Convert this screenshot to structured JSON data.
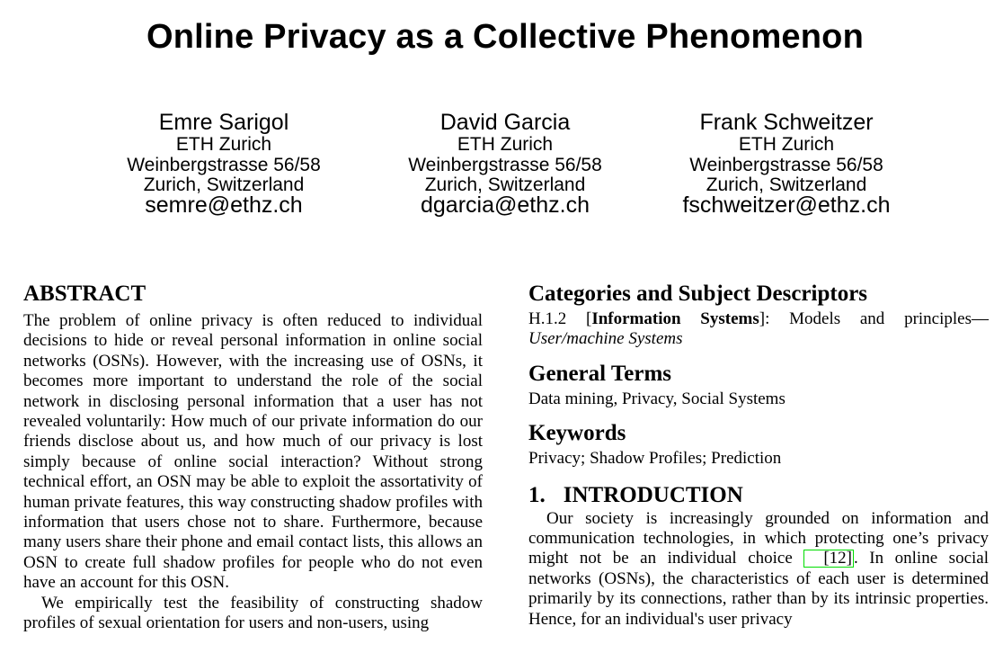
{
  "paper": {
    "title": "Online Privacy as a Collective Phenomenon",
    "authors": [
      {
        "name": "Emre Sarigol",
        "affiliation": "ETH Zurich",
        "address": "Weinbergstrasse 56/58",
        "city": "Zurich, Switzerland",
        "email": "semre@ethz.ch"
      },
      {
        "name": "David Garcia",
        "affiliation": "ETH Zurich",
        "address": "Weinbergstrasse 56/58",
        "city": "Zurich, Switzerland",
        "email": "dgarcia@ethz.ch"
      },
      {
        "name": "Frank Schweitzer",
        "affiliation": "ETH Zurich",
        "address": "Weinbergstrasse 56/58",
        "city": "Zurich, Switzerland",
        "email": "fschweitzer@ethz.ch"
      }
    ],
    "abstract": {
      "heading": "ABSTRACT",
      "para1": "The problem of online privacy is often reduced to individual decisions to hide or reveal personal information in online social networks (OSNs). However, with the increasing use of OSNs, it becomes more important to understand the role of the social network in disclosing personal information that a user has not revealed voluntarily: How much of our private information do our friends disclose about us, and how much of our privacy is lost simply because of online social interaction? Without strong technical effort, an OSN may be able to exploit the assortativity of human private features, this way constructing shadow profiles with information that users chose not to share. Furthermore, because many users share their phone and email contact lists, this allows an OSN to create full shadow profiles for people who do not even have an account for this OSN.",
      "para2": "We empirically test the feasibility of constructing shadow profiles of sexual orientation for users and non-users, using"
    },
    "categories": {
      "heading": "Categories and Subject Descriptors",
      "code": "H.1.2 [",
      "bold_term": "Information Systems",
      "rest": "]: Models and principles—",
      "italic_term": "User/machine Systems"
    },
    "general_terms": {
      "heading": "General Terms",
      "text": "Data mining, Privacy, Social Systems"
    },
    "keywords": {
      "heading": "Keywords",
      "text": "Privacy; Shadow Profiles; Prediction"
    },
    "introduction": {
      "number": "1.",
      "heading": "INTRODUCTION",
      "text_before_cite": "Our society is increasingly grounded on information and communication technologies, in which protecting one’s privacy might not be an individual choice ",
      "cite": "[12]",
      "text_after_cite": ". In online social networks (OSNs), the characteristics of each user is determined primarily by its connections, rather than by its intrinsic properties. Hence, for an individual's user privacy"
    }
  }
}
